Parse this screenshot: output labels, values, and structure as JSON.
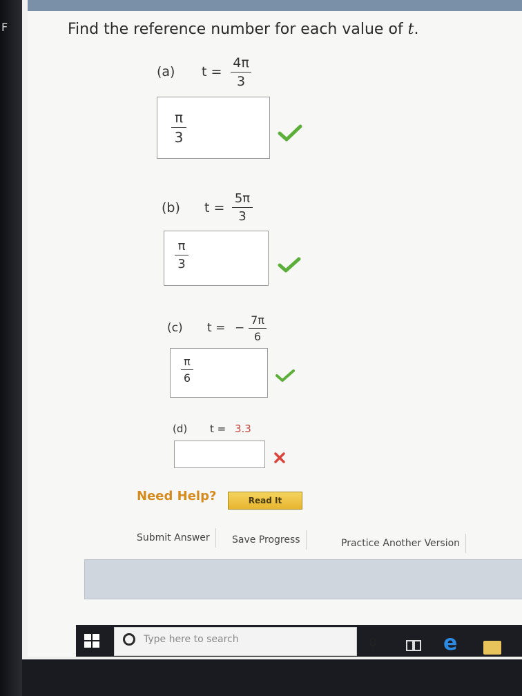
{
  "question": {
    "prefix": "Find the reference number for each value of ",
    "var": "t",
    "suffix": "."
  },
  "parts": [
    {
      "label": "(a)",
      "t_prefix": "t =",
      "sign": "",
      "num": "4π",
      "den": "3",
      "answer_num": "π",
      "answer_den": "3",
      "answer_text": "",
      "status": "correct"
    },
    {
      "label": "(b)",
      "t_prefix": "t =",
      "sign": "",
      "num": "5π",
      "den": "3",
      "answer_num": "π",
      "answer_den": "3",
      "answer_text": "",
      "status": "correct"
    },
    {
      "label": "(c)",
      "t_prefix": "t =",
      "sign": "−",
      "num": "7π",
      "den": "6",
      "answer_num": "π",
      "answer_den": "6",
      "answer_text": "",
      "status": "correct"
    },
    {
      "label": "(d)",
      "t_prefix": "t =",
      "value": "3.3",
      "answer_text": "",
      "status": "incorrect"
    }
  ],
  "help": {
    "label": "Need Help?",
    "read_it": "Read It"
  },
  "actions": {
    "submit": "Submit Answer",
    "save": "Save Progress",
    "practice": "Practice Another Version"
  },
  "taskbar": {
    "search_placeholder": "Type here to search"
  },
  "edge_letter": "F",
  "colors": {
    "check": "#5cae3a",
    "cross": "#d9453b",
    "need_help": "#d58a1d"
  }
}
